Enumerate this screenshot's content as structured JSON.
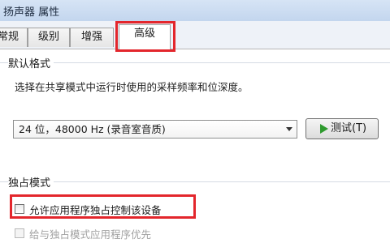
{
  "window": {
    "title": "扬声器 属性"
  },
  "tabs": [
    {
      "label": "常规",
      "active": false
    },
    {
      "label": "级别",
      "active": false
    },
    {
      "label": "增强",
      "active": false
    },
    {
      "label": "高级",
      "active": true
    }
  ],
  "default_format": {
    "group_label": "默认格式",
    "description": "选择在共享模式中运行时使用的采样频率和位深度。",
    "selected_format": "24 位，48000 Hz (录音室音质)",
    "test_button_label": "测试(T)",
    "test_icon": "play-icon"
  },
  "exclusive_mode": {
    "group_label": "独占模式",
    "allow_exclusive": {
      "label": "允许应用程序独占控制该设备",
      "checked": false
    },
    "give_priority": {
      "label": "给与独占模式应用程序优先",
      "checked": false,
      "disabled": true
    }
  },
  "colors": {
    "highlight": "#e3262c",
    "play_icon": "#2e9a2e",
    "disabled_text": "#a2a2a2"
  }
}
